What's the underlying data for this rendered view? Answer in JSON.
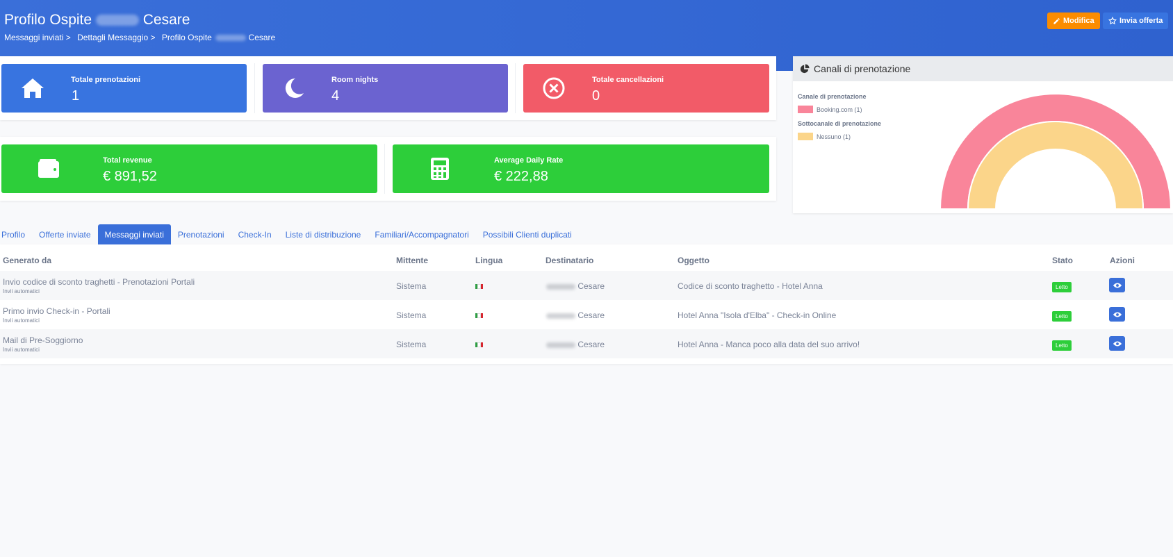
{
  "header": {
    "title_prefix": "Profilo Ospite",
    "title_suffix": "Cesare",
    "breadcrumb": [
      "Messaggi inviati >",
      "Dettagli Messaggio >",
      "Profilo Ospite"
    ],
    "breadcrumb_suffix": "Cesare",
    "edit_button": "Modifica",
    "offer_button": "Invia offerta"
  },
  "stats": [
    {
      "label": "Totale prenotazioni",
      "value": "1",
      "icon": "home-icon",
      "color": "#3874e0"
    },
    {
      "label": "Room nights",
      "value": "4",
      "icon": "moon-icon",
      "color": "#6b63d0"
    },
    {
      "label": "Totale cancellazioni",
      "value": "0",
      "icon": "cancel-icon",
      "color": "#f25b68"
    },
    {
      "label": "Total revenue",
      "value": "€ 891,52",
      "icon": "wallet-icon",
      "color": "#2dce3a"
    },
    {
      "label": "Average Daily Rate",
      "value": "€ 222,88",
      "icon": "calculator-icon",
      "color": "#2dce3a"
    }
  ],
  "channels": {
    "title": "Canali di prenotazione",
    "legend_title_1": "Canale di prenotazione",
    "legend_item_1": "Booking.com (1)",
    "legend_title_2": "Sottocanale di prenotazione",
    "legend_item_2": "Nessuno (1)",
    "color_outer": "#f9859a",
    "color_inner": "#fbd58a"
  },
  "tabs": [
    "Profilo",
    "Offerte inviate",
    "Messaggi inviati",
    "Prenotazioni",
    "Check-In",
    "Liste di distribuzione",
    "Familiari/Accompagnatori",
    "Possibili Clienti duplicati"
  ],
  "table": {
    "headers": [
      "Generato da",
      "Mittente",
      "Lingua",
      "Destinatario",
      "Oggetto",
      "Stato",
      "Azioni"
    ],
    "rows": [
      {
        "generated": "Invio codice di sconto traghetti - Prenotazioni Portali",
        "sub": "Invii automatici",
        "sender": "Sistema",
        "recipient": "Cesare",
        "subject": "Codice di sconto traghetto - Hotel Anna",
        "status": "Letto"
      },
      {
        "generated": "Primo invio Check-in - Portali",
        "sub": "Invii automatici",
        "sender": "Sistema",
        "recipient": "Cesare",
        "subject": "Hotel Anna \"Isola d'Elba\" - Check-in Online",
        "status": "Letto"
      },
      {
        "generated": "Mail di Pre-Soggiorno",
        "sub": "Invii automatici",
        "sender": "Sistema",
        "recipient": "Cesare",
        "subject": "Hotel Anna - Manca poco alla data del suo arrivo!",
        "status": "Letto"
      }
    ]
  }
}
